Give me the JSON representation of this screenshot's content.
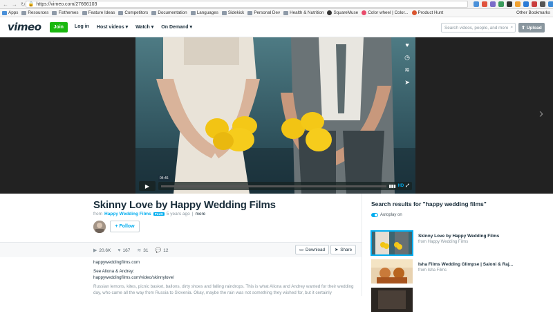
{
  "browser": {
    "url": "https://vimeo.com/27666103",
    "bookmarks": [
      {
        "label": "Apps",
        "kind": "apps"
      },
      {
        "label": "Resources",
        "kind": "folder"
      },
      {
        "label": "Fisthemes",
        "kind": "folder"
      },
      {
        "label": "Feature Ideas",
        "kind": "folder"
      },
      {
        "label": "Competitors",
        "kind": "folder"
      },
      {
        "label": "Documentation",
        "kind": "folder"
      },
      {
        "label": "Languages",
        "kind": "folder"
      },
      {
        "label": "Sidekick",
        "kind": "folder"
      },
      {
        "label": "Personal Dev",
        "kind": "folder"
      },
      {
        "label": "Health & Nutrition",
        "kind": "folder"
      },
      {
        "label": "SquareMuse",
        "kind": "site"
      },
      {
        "label": "Color wheel | Color...",
        "kind": "site"
      },
      {
        "label": "Product Hunt",
        "kind": "site"
      }
    ],
    "other_bookmarks": "Other Bookmarks"
  },
  "header": {
    "logo": "vimeo",
    "join_label": "Join",
    "nav": [
      "Log in",
      "Host videos",
      "Watch",
      "On Demand"
    ],
    "search_placeholder": "Search videos, people, and more",
    "upload_label": "Upload"
  },
  "player": {
    "timecode": "04:46",
    "hd_label": "HD",
    "side_icons": [
      "heart-icon",
      "clock-icon",
      "layers-icon",
      "send-icon"
    ]
  },
  "video": {
    "title": "Skinny Love by Happy Wedding Films",
    "from_label": "from",
    "author": "Happy Wedding Films",
    "badge": "PLUS",
    "age": "5 years ago",
    "more": "more",
    "follow_label": "Follow",
    "stats": {
      "plays": "20.6K",
      "likes": "167",
      "collections": "31",
      "comments": "12"
    },
    "download_label": "Download",
    "share_label": "Share",
    "description": {
      "link1": "happyweddingfilms.com",
      "see_label": "See Aliona & Andrey:",
      "link2": "happyweddingfilms.com/video/skinnylove/",
      "body": "Russian lemons, kites, picnic basket, ballons, dirty shoes and falling raindrops. This is what Aliona and Andrey wanted for their wedding day, who came all the way from Russia to Slovenia. Okay, maybe the rain was not something they wished for, but it certainly"
    }
  },
  "sidebar": {
    "title": "Search results for \"happy wedding films\"",
    "autoplay_label": "Autoplay on",
    "items": [
      {
        "title": "Skinny Love by Happy Wedding Films",
        "author": "from Happy Wedding Films",
        "active": true
      },
      {
        "title": "Isha Films Wedding Glimpse | Saloni & Raj...",
        "author": "from Isha Films",
        "active": false
      },
      {
        "title": "",
        "author": "",
        "active": false
      }
    ]
  },
  "colors": {
    "vimeo_blue": "#00adef",
    "join_green": "#19b70e",
    "text_dark": "#1a2e3b",
    "text_muted": "#8a979f"
  }
}
